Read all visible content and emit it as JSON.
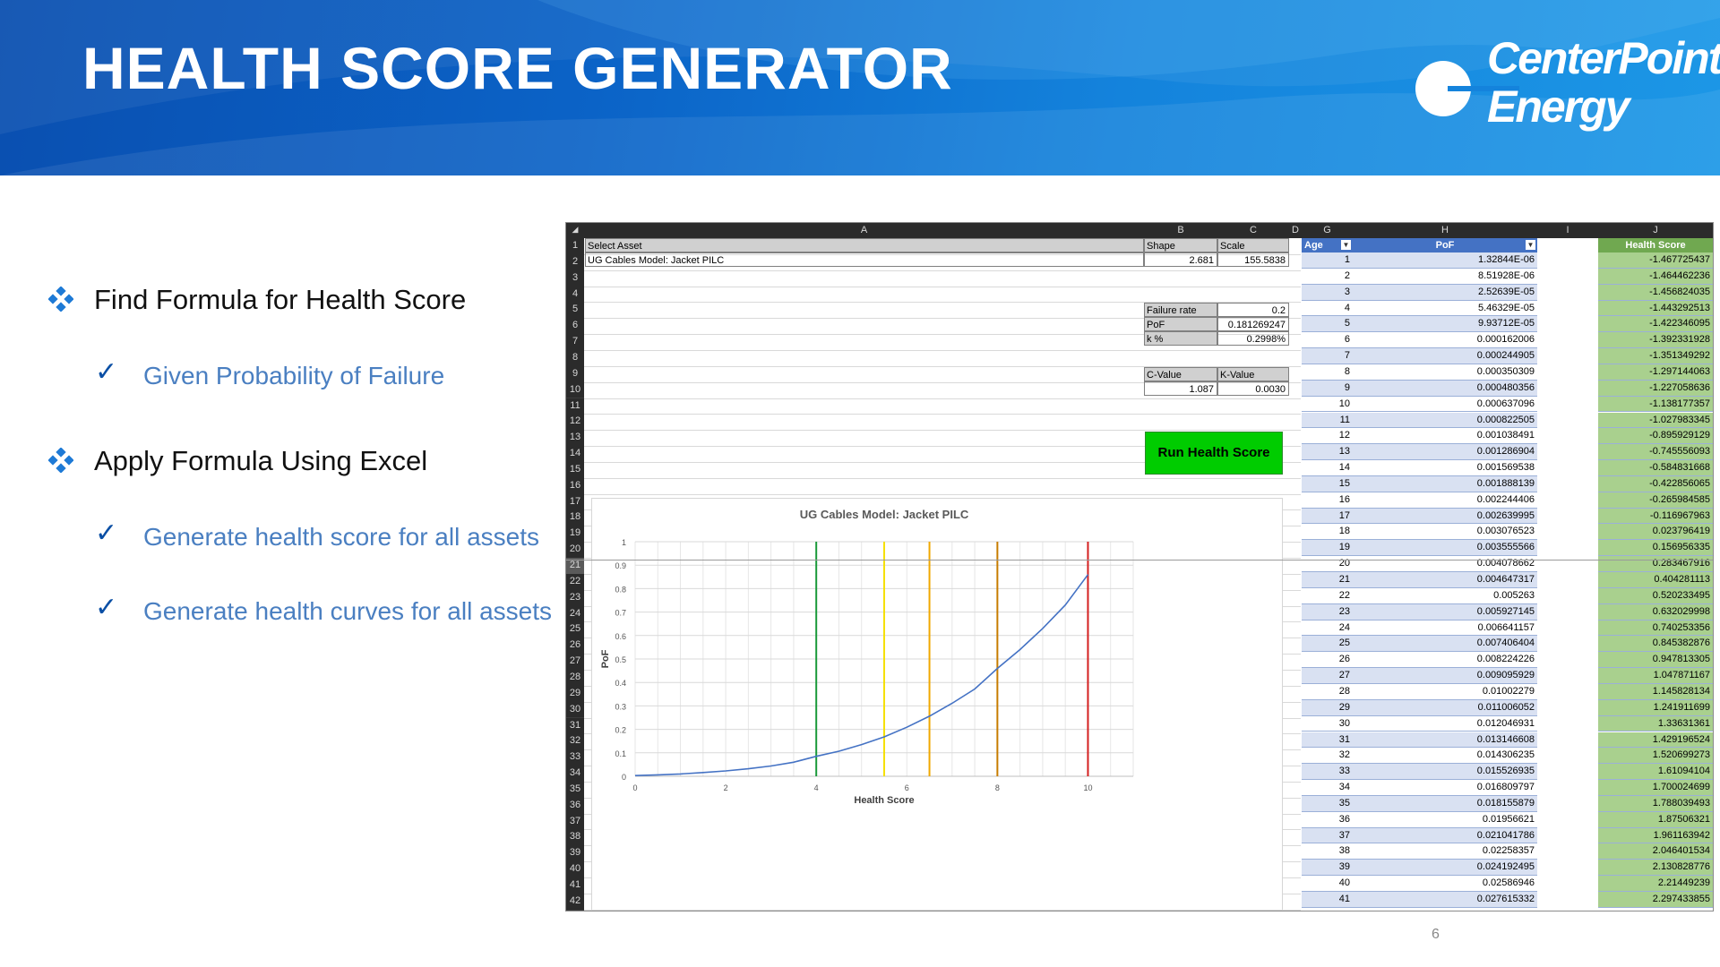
{
  "slide": {
    "title": "HEALTH SCORE GENERATOR",
    "logo_line1": "CenterPoint",
    "logo_line2": "Energy",
    "page_number": "6",
    "bullets": [
      {
        "text": "Find Formula for Health Score",
        "sub": [
          "Given Probability of Failure"
        ]
      },
      {
        "text": "Apply Formula Using Excel",
        "sub": [
          "Generate health score for all assets",
          "Generate health curves for all assets"
        ]
      }
    ]
  },
  "sheet": {
    "columns": [
      "A",
      "B",
      "C",
      "D",
      "G",
      "H",
      "I",
      "J"
    ],
    "rows": [
      "1",
      "2",
      "3",
      "4",
      "5",
      "6",
      "7",
      "8",
      "9",
      "10",
      "11",
      "12",
      "13",
      "14",
      "15",
      "16",
      "17",
      "18",
      "19",
      "20",
      "21",
      "22",
      "23",
      "24",
      "25",
      "26",
      "27",
      "28",
      "29",
      "30",
      "31",
      "32",
      "33",
      "34",
      "35",
      "36",
      "37",
      "38",
      "39",
      "40",
      "41",
      "42"
    ],
    "a1": "Select Asset",
    "b1": "Shape",
    "c1": "Scale",
    "a2": "UG Cables Model: Jacket PILC",
    "b2": "2.681",
    "c2": "155.5838",
    "failure_rate_label": "Failure rate",
    "failure_rate_value": "0.2",
    "pof_label": "PoF",
    "pof_value": "0.181269247",
    "k_label": "k %",
    "k_value": "0.2998%",
    "cvalue_label": "C-Value",
    "kvalue_label": "K-Value",
    "cvalue": "1.087",
    "kvalue": "0.0030",
    "button_label": "Run Health Score",
    "table_headers": {
      "age": "Age",
      "pof": "PoF",
      "health": "Health Score"
    },
    "table": [
      [
        "1",
        "1.32844E-06",
        "-1.467725437"
      ],
      [
        "2",
        "8.51928E-06",
        "-1.464462236"
      ],
      [
        "3",
        "2.52639E-05",
        "-1.456824035"
      ],
      [
        "4",
        "5.46329E-05",
        "-1.443292513"
      ],
      [
        "5",
        "9.93712E-05",
        "-1.422346095"
      ],
      [
        "6",
        "0.000162006",
        "-1.392331928"
      ],
      [
        "7",
        "0.000244905",
        "-1.351349292"
      ],
      [
        "8",
        "0.000350309",
        "-1.297144063"
      ],
      [
        "9",
        "0.000480356",
        "-1.227058636"
      ],
      [
        "10",
        "0.000637096",
        "-1.138177357"
      ],
      [
        "11",
        "0.000822505",
        "-1.027983345"
      ],
      [
        "12",
        "0.001038491",
        "-0.895929129"
      ],
      [
        "13",
        "0.001286904",
        "-0.745556093"
      ],
      [
        "14",
        "0.001569538",
        "-0.584831668"
      ],
      [
        "15",
        "0.001888139",
        "-0.422856065"
      ],
      [
        "16",
        "0.002244406",
        "-0.265984585"
      ],
      [
        "17",
        "0.002639995",
        "-0.116967963"
      ],
      [
        "18",
        "0.003076523",
        "0.023796419"
      ],
      [
        "19",
        "0.003555566",
        "0.156956335"
      ],
      [
        "20",
        "0.004078662",
        "0.283467916"
      ],
      [
        "21",
        "0.004647317",
        "0.404281113"
      ],
      [
        "22",
        "0.005263",
        "0.520233495"
      ],
      [
        "23",
        "0.005927145",
        "0.632029998"
      ],
      [
        "24",
        "0.006641157",
        "0.740253356"
      ],
      [
        "25",
        "0.007406404",
        "0.845382876"
      ],
      [
        "26",
        "0.008224226",
        "0.947813305"
      ],
      [
        "27",
        "0.009095929",
        "1.047871167"
      ],
      [
        "28",
        "0.01002279",
        "1.145828134"
      ],
      [
        "29",
        "0.011006052",
        "1.241911699"
      ],
      [
        "30",
        "0.012046931",
        "1.33631361"
      ],
      [
        "31",
        "0.013146608",
        "1.429196524"
      ],
      [
        "32",
        "0.014306235",
        "1.520699273"
      ],
      [
        "33",
        "0.015526935",
        "1.61094104"
      ],
      [
        "34",
        "0.016809797",
        "1.700024699"
      ],
      [
        "35",
        "0.018155879",
        "1.788039493"
      ],
      [
        "36",
        "0.01956621",
        "1.87506321"
      ],
      [
        "37",
        "0.021041786",
        "1.961163942"
      ],
      [
        "38",
        "0.02258357",
        "2.046401534"
      ],
      [
        "39",
        "0.024192495",
        "2.130828776"
      ],
      [
        "40",
        "0.02586946",
        "2.21449239"
      ],
      [
        "41",
        "0.027615332",
        "2.297433855"
      ]
    ]
  },
  "chart_data": {
    "type": "line",
    "title": "UG Cables Model: Jacket PILC",
    "xlabel": "Health Score",
    "ylabel": "PoF",
    "xlim": [
      0,
      11
    ],
    "ylim": [
      0,
      1
    ],
    "xticks": [
      "0",
      "2",
      "4",
      "6",
      "8",
      "10"
    ],
    "yticks": [
      "0",
      "0.1",
      "0.2",
      "0.3",
      "0.4",
      "0.5",
      "0.6",
      "0.7",
      "0.8",
      "0.9",
      "1"
    ],
    "grid": true,
    "x": [
      0,
      0.5,
      1,
      1.5,
      2,
      2.5,
      3,
      3.5,
      4,
      4.5,
      5,
      5.5,
      6,
      6.5,
      7,
      7.5,
      8,
      8.5,
      9,
      9.5,
      10
    ],
    "y": [
      0.003,
      0.006,
      0.01,
      0.016,
      0.023,
      0.032,
      0.044,
      0.06,
      0.085,
      0.107,
      0.135,
      0.168,
      0.209,
      0.256,
      0.311,
      0.372,
      0.46,
      0.54,
      0.63,
      0.73,
      0.86
    ],
    "line_color": "#4472c4",
    "vlines": [
      {
        "x": 4,
        "color": "#1a9a3a"
      },
      {
        "x": 5.5,
        "color": "#f5e000"
      },
      {
        "x": 6.5,
        "color": "#f0a800"
      },
      {
        "x": 8,
        "color": "#c77c00"
      },
      {
        "x": 10,
        "color": "#d42020"
      }
    ]
  }
}
